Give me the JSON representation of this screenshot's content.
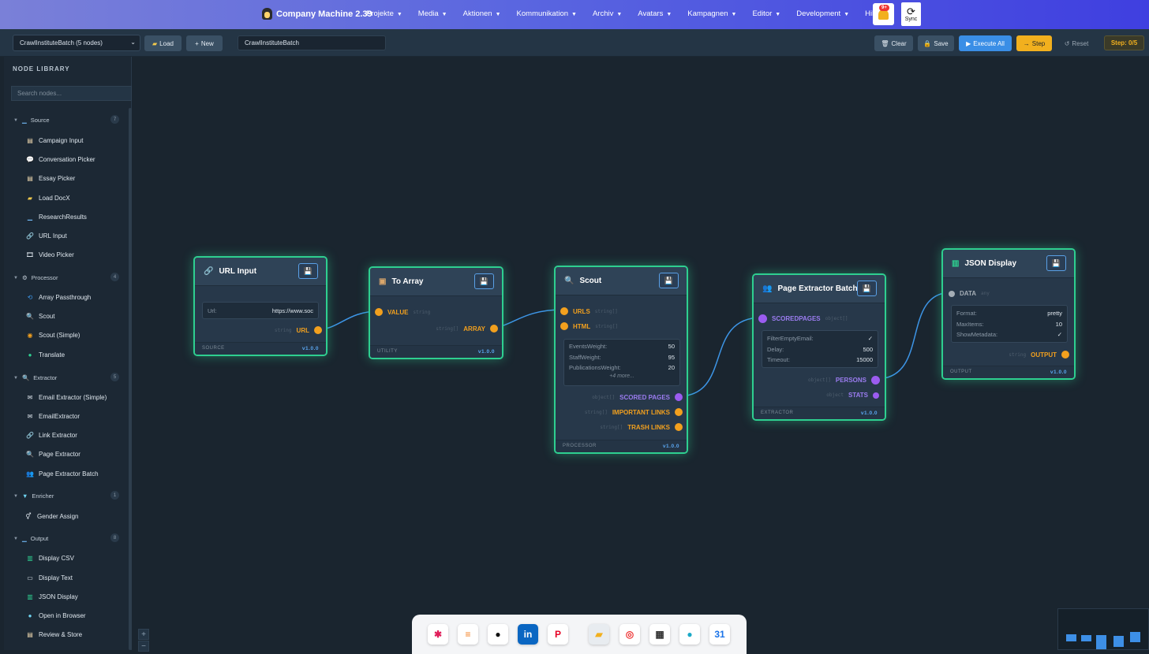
{
  "app": {
    "title": "Company Machine 2.39"
  },
  "menu": [
    {
      "label": "Projekte"
    },
    {
      "label": "Media"
    },
    {
      "label": "Aktionen"
    },
    {
      "label": "Kommunikation"
    },
    {
      "label": "Archiv"
    },
    {
      "label": "Avatars"
    },
    {
      "label": "Kampagnen"
    },
    {
      "label": "Editor"
    },
    {
      "label": "Development"
    },
    {
      "label": "Hilfe"
    }
  ],
  "notifications": {
    "badge": "9+"
  },
  "sync": {
    "label": "Sync"
  },
  "toolbar": {
    "workflow_select": "CrawlInstituteBatch (5 nodes)",
    "load": "Load",
    "new": "New",
    "workflow_name": "CrawlInstituteBatch",
    "clear": "Clear",
    "save": "Save",
    "execute_all": "Execute All",
    "step": "Step",
    "reset": "Reset",
    "step_indicator": "Step: 0/5"
  },
  "library": {
    "title": "NODE LIBRARY",
    "search_placeholder": "Search nodes...",
    "categories": [
      {
        "name": "Source",
        "count": "7",
        "items": [
          "Campaign Input",
          "Conversation Picker",
          "Essay Picker",
          "Load DocX",
          "ResearchResults",
          "URL Input",
          "Video Picker"
        ]
      },
      {
        "name": "Processor",
        "count": "4",
        "items": [
          "Array Passthrough",
          "Scout",
          "Scout (Simple)",
          "Translate"
        ]
      },
      {
        "name": "Extractor",
        "count": "5",
        "items": [
          "Email Extractor (Simple)",
          "EmailExtractor",
          "Link Extractor",
          "Page Extractor",
          "Page Extractor Batch"
        ]
      },
      {
        "name": "Enricher",
        "count": "1",
        "items": [
          "Gender Assign"
        ]
      },
      {
        "name": "Output",
        "count": "8",
        "items": [
          "Display CSV",
          "Display Text",
          "JSON Display",
          "Open in Browser",
          "Review & Store"
        ]
      }
    ]
  },
  "nodes": {
    "url_input": {
      "title": "URL Input",
      "field_label": "Url:",
      "field_value": "https://www.soc",
      "out_type": "string",
      "out_label": "URL",
      "category": "SOURCE",
      "version": "v1.0.0"
    },
    "to_array": {
      "title": "To Array",
      "in_label": "VALUE",
      "in_type": "string",
      "out_type": "string[]",
      "out_label": "ARRAY",
      "category": "UTILITY",
      "version": "v1.0.0"
    },
    "scout": {
      "title": "Scout",
      "in1_label": "URLS",
      "in1_type": "string[]",
      "in2_label": "HTML",
      "in2_type": "string[]",
      "params": [
        {
          "k": "EventsWeight:",
          "v": "50"
        },
        {
          "k": "StaffWeight:",
          "v": "95"
        },
        {
          "k": "PublicationsWeight:",
          "v": "20"
        }
      ],
      "more": "+4 more...",
      "out1_type": "object[]",
      "out1_label": "SCORED PAGES",
      "out2_type": "string[]",
      "out2_label": "IMPORTANT LINKS",
      "out3_type": "string[]",
      "out3_label": "TRASH LINKS",
      "category": "PROCESSOR",
      "version": "v1.0.0"
    },
    "page_extractor": {
      "title": "Page Extractor Batch",
      "in_label": "SCOREDPAGES",
      "in_type": "object[]",
      "params": [
        {
          "k": "FilterEmptyEmail:",
          "v": "✓"
        },
        {
          "k": "Delay:",
          "v": "500"
        },
        {
          "k": "Timeout:",
          "v": "15000"
        }
      ],
      "out1_type": "object[]",
      "out1_label": "PERSONS",
      "out2_type": "object",
      "out2_label": "STATS",
      "category": "EXTRACTOR",
      "version": "v1.0.0"
    },
    "json_display": {
      "title": "JSON Display",
      "in_label": "DATA",
      "in_type": "any",
      "params": [
        {
          "k": "Format:",
          "v": "pretty"
        },
        {
          "k": "MaxItems:",
          "v": "10"
        },
        {
          "k": "ShowMetadata:",
          "v": "✓"
        }
      ],
      "out_type": "string",
      "out_label": "OUTPUT",
      "category": "OUTPUT",
      "version": "v1.0.0"
    }
  },
  "dock": [
    "slack-icon",
    "bookmark-icon",
    "github-icon",
    "linkedin-icon",
    "pinterest-icon",
    "folder-icon",
    "app-icon",
    "grid-icon",
    "circle-icon",
    "calendar-icon"
  ],
  "colors": {
    "accent_green": "#2ecf90",
    "port_orange": "#f2a01e",
    "port_purple": "#9b5cf0",
    "wire_blue": "#3d95e6"
  }
}
